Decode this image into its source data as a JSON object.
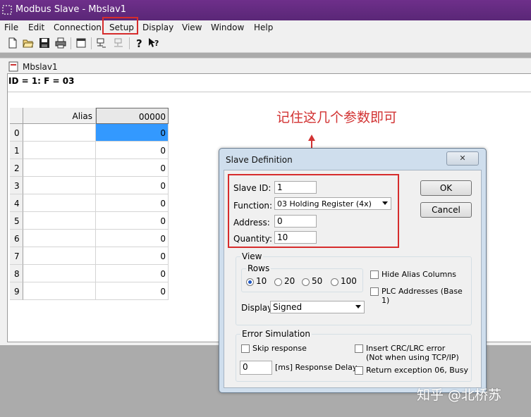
{
  "window": {
    "title": "Modbus Slave - Mbslav1"
  },
  "menubar": {
    "items": [
      "File",
      "Edit",
      "Connection",
      "Setup",
      "Display",
      "View",
      "Window",
      "Help"
    ]
  },
  "toolbar": {
    "icons": [
      "new-icon",
      "open-icon",
      "save-icon",
      "print-icon",
      "window-icon",
      "connect-icon",
      "disconnect-icon",
      "help-icon",
      "context-help-icon"
    ]
  },
  "child": {
    "title": "Mbslav1",
    "id_line": "ID = 1: F = 03",
    "grid": {
      "alias_header": "Alias",
      "address_header": "00000",
      "rows": [
        {
          "index": "0",
          "alias": "",
          "value": "0"
        },
        {
          "index": "1",
          "alias": "",
          "value": "0"
        },
        {
          "index": "2",
          "alias": "",
          "value": "0"
        },
        {
          "index": "3",
          "alias": "",
          "value": "0"
        },
        {
          "index": "4",
          "alias": "",
          "value": "0"
        },
        {
          "index": "5",
          "alias": "",
          "value": "0"
        },
        {
          "index": "6",
          "alias": "",
          "value": "0"
        },
        {
          "index": "7",
          "alias": "",
          "value": "0"
        },
        {
          "index": "8",
          "alias": "",
          "value": "0"
        },
        {
          "index": "9",
          "alias": "",
          "value": "0"
        }
      ],
      "selected_row": 0
    }
  },
  "annotation": {
    "text": "记住这几个参数即可",
    "color": "#d23333"
  },
  "dialog": {
    "title": "Slave Definition",
    "close_label": "✕",
    "slave_id_label": "Slave ID:",
    "slave_id_value": "1",
    "function_label": "Function:",
    "function_value": "03 Holding Register (4x)",
    "address_label": "Address:",
    "address_value": "0",
    "quantity_label": "Quantity:",
    "quantity_value": "10",
    "ok_label": "OK",
    "cancel_label": "Cancel",
    "view": {
      "title": "View",
      "rows_title": "Rows",
      "row_options": [
        "10",
        "20",
        "50",
        "100"
      ],
      "selected_rows": "10",
      "hide_alias_label": "Hide Alias Columns",
      "hide_alias_checked": false,
      "plc_addresses_label": "PLC Addresses (Base 1)",
      "plc_addresses_checked": false,
      "display_label": "Display:",
      "display_value": "Signed"
    },
    "error_simulation": {
      "title": "Error Simulation",
      "skip_response_label": "Skip response",
      "skip_response_checked": false,
      "response_delay_value": "0",
      "response_delay_label": "[ms] Response Delay",
      "insert_crc_label": "Insert CRC/LRC error",
      "insert_crc_sublabel": "(Not when using TCP/IP)",
      "insert_crc_checked": false,
      "return_exception_label": "Return exception 06, Busy",
      "return_exception_checked": false
    }
  },
  "watermark": {
    "text": "知乎 @北桥苏"
  },
  "colors": {
    "highlight": "#d62c2c",
    "title_bar": "#5a2777",
    "selected_cell": "#3399ff"
  }
}
